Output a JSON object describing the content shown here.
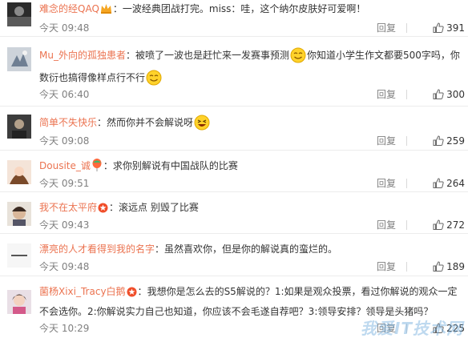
{
  "comments": [
    {
      "username": "难念的经QAQ",
      "badge": "crown",
      "text": "一波经典团战打完。miss：哇，这个纳尔皮肤好可爱啊！",
      "time": "今天 09:48",
      "reply": "回复",
      "likes": "391"
    },
    {
      "username": "Mu_外向的孤独患者",
      "badge": "",
      "text_a": "被喷了一波也是赶忙来一发赛事预测",
      "text_b": "你知道小学生作文都要500字吗，你",
      "text_c": "数衍也搞得像样点行不行",
      "time": "今天 06:40",
      "reply": "回复",
      "likes": "300"
    },
    {
      "username": "简单不失快乐",
      "badge": "",
      "text": "然而你并不会解说呀",
      "time": "今天 09:08",
      "reply": "回复",
      "likes": "259"
    },
    {
      "username": "Dousite_诚",
      "badge": "balloon",
      "text": "求你别解说有中国战队的比赛",
      "time": "今天 09:51",
      "reply": "回复",
      "likes": "264"
    },
    {
      "username": "我不在太平府",
      "badge": "star",
      "text": "滚远点 别毁了比赛",
      "time": "今天 09:43",
      "reply": "回复",
      "likes": "272"
    },
    {
      "username": "漂亮的人才看得到我的名字",
      "badge": "",
      "text": "虽然喜欢你，但是你的解说真的蛮烂的。",
      "time": "今天 09:48",
      "reply": "回复",
      "likes": "189"
    },
    {
      "username": "菌杨Xixi_Tracy白鹅",
      "badge": "star",
      "text_a": "我想你是怎么去的S5解说的？1:如果是观众投票，看过你解说的观众一定",
      "text_b": "不会选你。2:你解说实力自己也知道，你应该不会毛遂自荐吧？3:领导安排？领导是头猪吗？",
      "time": "今天 10:29",
      "reply": "回复",
      "likes": "225"
    }
  ],
  "watermark": "我爱IT技术网"
}
